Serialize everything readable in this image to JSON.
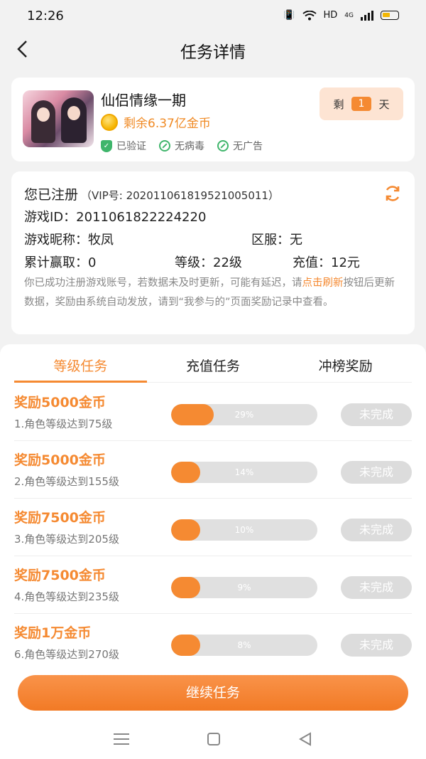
{
  "status_bar": {
    "time": "12:26",
    "network": "HD",
    "signal": "4G"
  },
  "header": {
    "title": "任务详情"
  },
  "game": {
    "name": "仙侣情缘一期",
    "coins_left": "剩余6.37亿金币",
    "badges": [
      "已验证",
      "无病毒",
      "无广告"
    ],
    "remain_prefix": "剩",
    "remain_days": "1",
    "remain_suffix": "天"
  },
  "registration": {
    "title": "您已注册",
    "vip": "（VIP号: 20201106181952100501​1）",
    "game_id": "游戏ID：2011061822224220",
    "nickname": "游戏昵称：牧凤",
    "server": "区服：无",
    "earned": "累计赢取：0",
    "level": "等级：22级",
    "recharge": "充值：12元",
    "note_before": "你已成功注册游戏账号，若数据未及时更新，可能有延迟，请",
    "note_link": "点击刷新",
    "note_after": "按钮后更新数据，奖励由系统自动发放，请到“我参与的”页面奖励记录中查看。"
  },
  "tabs": [
    {
      "label": "等级任务",
      "active": true
    },
    {
      "label": "充值任务",
      "active": false
    },
    {
      "label": "冲榜奖励",
      "active": false
    }
  ],
  "tasks": [
    {
      "reward": "奖励5000金币",
      "desc": "1.角色等级达到75级",
      "progress": 29,
      "progress_label": "29%",
      "status": "未完成"
    },
    {
      "reward": "奖励5000金币",
      "desc": "2.角色等级达到155级",
      "progress": 14,
      "progress_label": "14%",
      "status": "未完成"
    },
    {
      "reward": "奖励7500金币",
      "desc": "3.角色等级达到205级",
      "progress": 10,
      "progress_label": "10%",
      "status": "未完成"
    },
    {
      "reward": "奖励7500金币",
      "desc": "4.角色等级达到235级",
      "progress": 9,
      "progress_label": "9%",
      "status": "未完成"
    },
    {
      "reward": "奖励1万金币",
      "desc": "6.角色等级达到270级",
      "progress": 8,
      "progress_label": "8%",
      "status": "未完成"
    }
  ],
  "continue_button": "继续任务",
  "colors": {
    "accent": "#f58a32",
    "verified": "#3fb56b",
    "disabled": "#dcdcdc"
  }
}
